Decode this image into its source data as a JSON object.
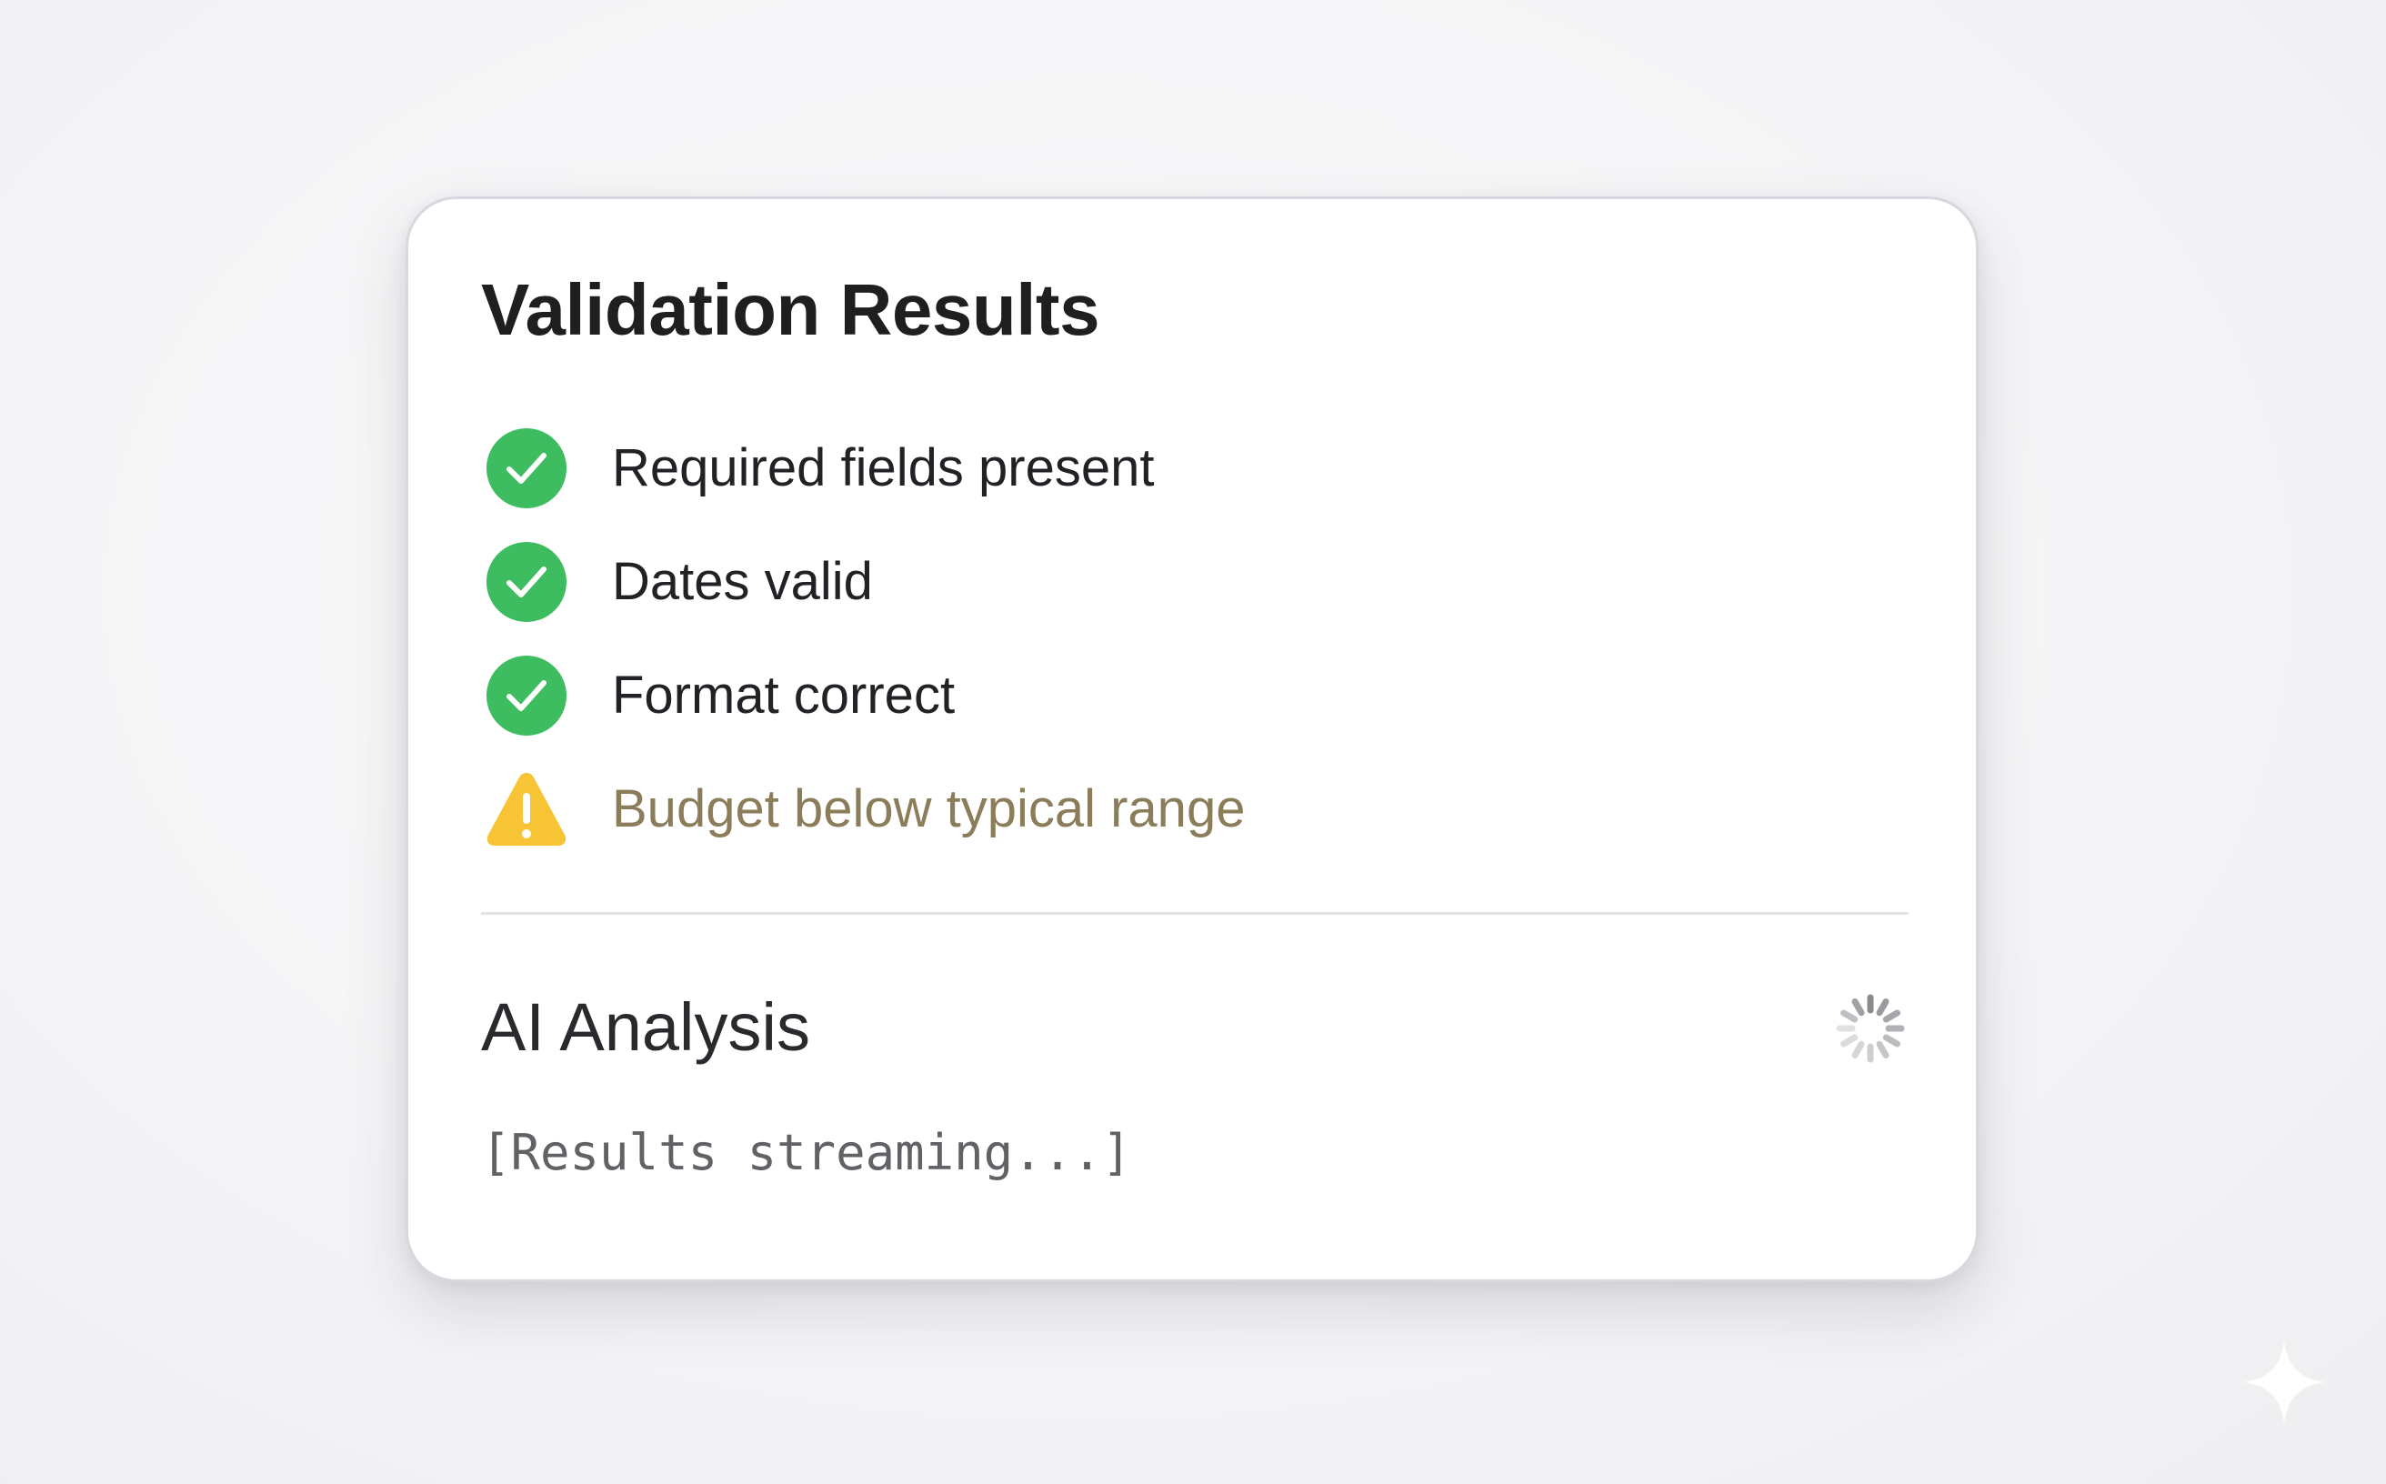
{
  "panel": {
    "title": "Validation Results",
    "checks": [
      {
        "label": "Required fields present",
        "status": "pass",
        "icon": "check-circle-icon"
      },
      {
        "label": "Dates valid",
        "status": "pass",
        "icon": "check-circle-icon"
      },
      {
        "label": "Format correct",
        "status": "pass",
        "icon": "check-circle-icon"
      },
      {
        "label": "Budget below typical range",
        "status": "warning",
        "icon": "warning-triangle-icon"
      }
    ],
    "analysis": {
      "title": "AI Analysis",
      "status_icon": "loading-spinner-icon",
      "stream_text": "[Results streaming...]"
    }
  },
  "colors": {
    "pass": "#3dbd5f",
    "warning": "#f7c436",
    "warning_text": "#8b7d5a",
    "title_text": "#1f1f22",
    "body_text": "#222226",
    "monospace_text": "#616166",
    "divider": "#e3e3e8",
    "card_border": "#d8d8de"
  },
  "watermark": {
    "icon": "sparkle-icon"
  }
}
